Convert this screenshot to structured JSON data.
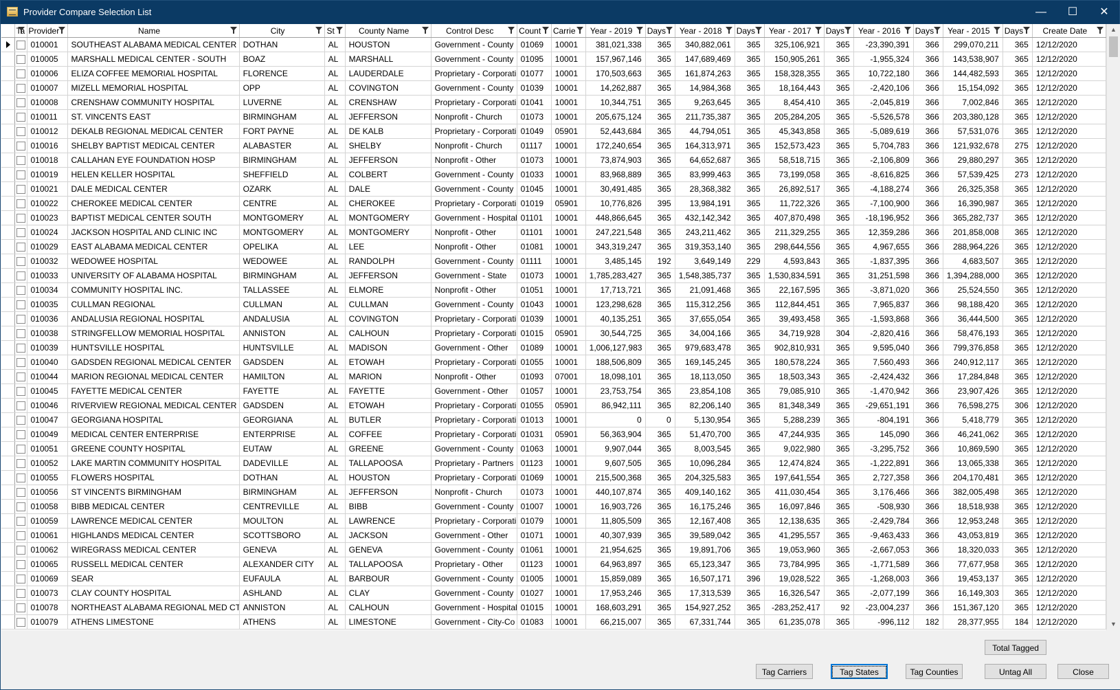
{
  "window": {
    "title": "Provider Compare Selection List",
    "minimize": "—",
    "maximize": "☐",
    "close": "✕"
  },
  "columns": [
    "Ta",
    "Provider",
    "Name",
    "City",
    "St",
    "County Name",
    "Control Desc",
    "Count",
    "Carrie",
    "Year - 2019",
    "Days",
    "Year - 2018",
    "Days",
    "Year - 2017",
    "Days",
    "Year - 2016",
    "Days",
    "Year - 2015",
    "Days",
    "Create Date"
  ],
  "rows": [
    [
      "010001",
      "SOUTHEAST ALABAMA MEDICAL CENTER",
      "DOTHAN",
      "AL",
      "HOUSTON",
      "Government - County",
      "01069",
      "10001",
      "381,021,338",
      "365",
      "340,882,061",
      "365",
      "325,106,921",
      "365",
      "-23,390,391",
      "366",
      "299,070,211",
      "365",
      "12/12/2020"
    ],
    [
      "010005",
      "MARSHALL MEDICAL CENTER - SOUTH",
      "BOAZ",
      "AL",
      "MARSHALL",
      "Government - County",
      "01095",
      "10001",
      "157,967,146",
      "365",
      "147,689,469",
      "365",
      "150,905,261",
      "365",
      "-1,955,324",
      "366",
      "143,538,907",
      "365",
      "12/12/2020"
    ],
    [
      "010006",
      "ELIZA COFFEE MEMORIAL HOSPITAL",
      "FLORENCE",
      "AL",
      "LAUDERDALE",
      "Proprietary - Corporati",
      "01077",
      "10001",
      "170,503,663",
      "365",
      "161,874,263",
      "365",
      "158,328,355",
      "365",
      "10,722,180",
      "366",
      "144,482,593",
      "365",
      "12/12/2020"
    ],
    [
      "010007",
      "MIZELL MEMORIAL HOSPITAL",
      "OPP",
      "AL",
      "COVINGTON",
      "Government - County",
      "01039",
      "10001",
      "14,262,887",
      "365",
      "14,984,368",
      "365",
      "18,164,443",
      "365",
      "-2,420,106",
      "366",
      "15,154,092",
      "365",
      "12/12/2020"
    ],
    [
      "010008",
      "CRENSHAW COMMUNITY HOSPITAL",
      "LUVERNE",
      "AL",
      "CRENSHAW",
      "Proprietary - Corporati",
      "01041",
      "10001",
      "10,344,751",
      "365",
      "9,263,645",
      "365",
      "8,454,410",
      "365",
      "-2,045,819",
      "366",
      "7,002,846",
      "365",
      "12/12/2020"
    ],
    [
      "010011",
      "ST. VINCENTS EAST",
      "BIRMINGHAM",
      "AL",
      "JEFFERSON",
      "Nonprofit - Church",
      "01073",
      "10001",
      "205,675,124",
      "365",
      "211,735,387",
      "365",
      "205,284,205",
      "365",
      "-5,526,578",
      "366",
      "203,380,128",
      "365",
      "12/12/2020"
    ],
    [
      "010012",
      "DEKALB REGIONAL MEDICAL CENTER",
      "FORT PAYNE",
      "AL",
      "DE KALB",
      "Proprietary - Corporati",
      "01049",
      "05901",
      "52,443,684",
      "365",
      "44,794,051",
      "365",
      "45,343,858",
      "365",
      "-5,089,619",
      "366",
      "57,531,076",
      "365",
      "12/12/2020"
    ],
    [
      "010016",
      "SHELBY BAPTIST MEDICAL CENTER",
      "ALABASTER",
      "AL",
      "SHELBY",
      "Nonprofit - Church",
      "01117",
      "10001",
      "172,240,654",
      "365",
      "164,313,971",
      "365",
      "152,573,423",
      "365",
      "5,704,783",
      "366",
      "121,932,678",
      "275",
      "12/12/2020"
    ],
    [
      "010018",
      "CALLAHAN EYE FOUNDATION HOSP",
      "BIRMINGHAM",
      "AL",
      "JEFFERSON",
      "Nonprofit - Other",
      "01073",
      "10001",
      "73,874,903",
      "365",
      "64,652,687",
      "365",
      "58,518,715",
      "365",
      "-2,106,809",
      "366",
      "29,880,297",
      "365",
      "12/12/2020"
    ],
    [
      "010019",
      "HELEN KELLER HOSPITAL",
      "SHEFFIELD",
      "AL",
      "COLBERT",
      "Government - County",
      "01033",
      "10001",
      "83,968,889",
      "365",
      "83,999,463",
      "365",
      "73,199,058",
      "365",
      "-8,616,825",
      "366",
      "57,539,425",
      "273",
      "12/12/2020"
    ],
    [
      "010021",
      "DALE MEDICAL CENTER",
      "OZARK",
      "AL",
      "DALE",
      "Government - County",
      "01045",
      "10001",
      "30,491,485",
      "365",
      "28,368,382",
      "365",
      "26,892,517",
      "365",
      "-4,188,274",
      "366",
      "26,325,358",
      "365",
      "12/12/2020"
    ],
    [
      "010022",
      "CHEROKEE MEDICAL CENTER",
      "CENTRE",
      "AL",
      "CHEROKEE",
      "Proprietary - Corporati",
      "01019",
      "05901",
      "10,776,826",
      "395",
      "13,984,191",
      "365",
      "11,722,326",
      "365",
      "-7,100,900",
      "366",
      "16,390,987",
      "365",
      "12/12/2020"
    ],
    [
      "010023",
      "BAPTIST MEDICAL CENTER SOUTH",
      "MONTGOMERY",
      "AL",
      "MONTGOMERY",
      "Government - Hospital",
      "01101",
      "10001",
      "448,866,645",
      "365",
      "432,142,342",
      "365",
      "407,870,498",
      "365",
      "-18,196,952",
      "366",
      "365,282,737",
      "365",
      "12/12/2020"
    ],
    [
      "010024",
      "JACKSON HOSPITAL AND CLINIC  INC",
      "MONTGOMERY",
      "AL",
      "MONTGOMERY",
      "Nonprofit - Other",
      "01101",
      "10001",
      "247,221,548",
      "365",
      "243,211,462",
      "365",
      "211,329,255",
      "365",
      "12,359,286",
      "366",
      "201,858,008",
      "365",
      "12/12/2020"
    ],
    [
      "010029",
      "EAST ALABAMA MEDICAL CENTER",
      "OPELIKA",
      "AL",
      "LEE",
      "Nonprofit - Other",
      "01081",
      "10001",
      "343,319,247",
      "365",
      "319,353,140",
      "365",
      "298,644,556",
      "365",
      "4,967,655",
      "366",
      "288,964,226",
      "365",
      "12/12/2020"
    ],
    [
      "010032",
      "WEDOWEE HOSPITAL",
      "WEDOWEE",
      "AL",
      "RANDOLPH",
      "Government - County",
      "01111",
      "10001",
      "3,485,145",
      "192",
      "3,649,149",
      "229",
      "4,593,843",
      "365",
      "-1,837,395",
      "366",
      "4,683,507",
      "365",
      "12/12/2020"
    ],
    [
      "010033",
      "UNIVERSITY OF ALABAMA HOSPITAL",
      "BIRMINGHAM",
      "AL",
      "JEFFERSON",
      "Government - State",
      "01073",
      "10001",
      "1,785,283,427",
      "365",
      "1,548,385,737",
      "365",
      "1,530,834,591",
      "365",
      "31,251,598",
      "366",
      "1,394,288,000",
      "365",
      "12/12/2020"
    ],
    [
      "010034",
      "COMMUNITY HOSPITAL INC.",
      "TALLASSEE",
      "AL",
      "ELMORE",
      "Nonprofit - Other",
      "01051",
      "10001",
      "17,713,721",
      "365",
      "21,091,468",
      "365",
      "22,167,595",
      "365",
      "-3,871,020",
      "366",
      "25,524,550",
      "365",
      "12/12/2020"
    ],
    [
      "010035",
      "CULLMAN REGIONAL",
      "CULLMAN",
      "AL",
      "CULLMAN",
      "Government - County",
      "01043",
      "10001",
      "123,298,628",
      "365",
      "115,312,256",
      "365",
      "112,844,451",
      "365",
      "7,965,837",
      "366",
      "98,188,420",
      "365",
      "12/12/2020"
    ],
    [
      "010036",
      "ANDALUSIA REGIONAL HOSPITAL",
      "ANDALUSIA",
      "AL",
      "COVINGTON",
      "Proprietary - Corporati",
      "01039",
      "10001",
      "40,135,251",
      "365",
      "37,655,054",
      "365",
      "39,493,458",
      "365",
      "-1,593,868",
      "366",
      "36,444,500",
      "365",
      "12/12/2020"
    ],
    [
      "010038",
      "STRINGFELLOW MEMORIAL HOSPITAL",
      "ANNISTON",
      "AL",
      "CALHOUN",
      "Proprietary - Corporati",
      "01015",
      "05901",
      "30,544,725",
      "365",
      "34,004,166",
      "365",
      "34,719,928",
      "304",
      "-2,820,416",
      "366",
      "58,476,193",
      "365",
      "12/12/2020"
    ],
    [
      "010039",
      "HUNTSVILLE HOSPITAL",
      "HUNTSVILLE",
      "AL",
      "MADISON",
      "Government - Other",
      "01089",
      "10001",
      "1,006,127,983",
      "365",
      "979,683,478",
      "365",
      "902,810,931",
      "365",
      "9,595,040",
      "366",
      "799,376,858",
      "365",
      "12/12/2020"
    ],
    [
      "010040",
      "GADSDEN REGIONAL MEDICAL CENTER",
      "GADSDEN",
      "AL",
      "ETOWAH",
      "Proprietary - Corporati",
      "01055",
      "10001",
      "188,506,809",
      "365",
      "169,145,245",
      "365",
      "180,578,224",
      "365",
      "7,560,493",
      "366",
      "240,912,117",
      "365",
      "12/12/2020"
    ],
    [
      "010044",
      "MARION REGIONAL MEDICAL CENTER",
      "HAMILTON",
      "AL",
      "MARION",
      "Nonprofit - Other",
      "01093",
      "07001",
      "18,098,101",
      "365",
      "18,113,050",
      "365",
      "18,503,343",
      "365",
      "-2,424,432",
      "366",
      "17,284,848",
      "365",
      "12/12/2020"
    ],
    [
      "010045",
      "FAYETTE MEDICAL CENTER",
      "FAYETTE",
      "AL",
      "FAYETTE",
      "Government - Other",
      "01057",
      "10001",
      "23,753,754",
      "365",
      "23,854,108",
      "365",
      "79,085,910",
      "365",
      "-1,470,942",
      "366",
      "23,907,426",
      "365",
      "12/12/2020"
    ],
    [
      "010046",
      "RIVERVIEW REGIONAL MEDICAL CENTER",
      "GADSDEN",
      "AL",
      "ETOWAH",
      "Proprietary - Corporati",
      "01055",
      "05901",
      "86,942,111",
      "365",
      "82,206,140",
      "365",
      "81,348,349",
      "365",
      "-29,651,191",
      "366",
      "76,598,275",
      "306",
      "12/12/2020"
    ],
    [
      "010047",
      "GEORGIANA HOSPITAL",
      "GEORGIANA",
      "AL",
      "BUTLER",
      "Proprietary - Corporati",
      "01013",
      "10001",
      "0",
      "0",
      "5,130,954",
      "365",
      "5,288,239",
      "365",
      "-804,191",
      "366",
      "5,418,779",
      "365",
      "12/12/2020"
    ],
    [
      "010049",
      "MEDICAL CENTER ENTERPRISE",
      "ENTERPRISE",
      "AL",
      "COFFEE",
      "Proprietary - Corporati",
      "01031",
      "05901",
      "56,363,904",
      "365",
      "51,470,700",
      "365",
      "47,244,935",
      "365",
      "145,090",
      "366",
      "46,241,062",
      "365",
      "12/12/2020"
    ],
    [
      "010051",
      "GREENE COUNTY HOSPITAL",
      "EUTAW",
      "AL",
      "GREENE",
      "Government - County",
      "01063",
      "10001",
      "9,907,044",
      "365",
      "8,003,545",
      "365",
      "9,022,980",
      "365",
      "-3,295,752",
      "366",
      "10,869,590",
      "365",
      "12/12/2020"
    ],
    [
      "010052",
      "LAKE MARTIN COMMUNITY HOSPITAL",
      "DADEVILLE",
      "AL",
      "TALLAPOOSA",
      "Proprietary - Partners",
      "01123",
      "10001",
      "9,607,505",
      "365",
      "10,096,284",
      "365",
      "12,474,824",
      "365",
      "-1,222,891",
      "366",
      "13,065,338",
      "365",
      "12/12/2020"
    ],
    [
      "010055",
      "FLOWERS HOSPITAL",
      "DOTHAN",
      "AL",
      "HOUSTON",
      "Proprietary - Corporati",
      "01069",
      "10001",
      "215,500,368",
      "365",
      "204,325,583",
      "365",
      "197,641,554",
      "365",
      "2,727,358",
      "366",
      "204,170,481",
      "365",
      "12/12/2020"
    ],
    [
      "010056",
      "ST VINCENTS BIRMINGHAM",
      "BIRMINGHAM",
      "AL",
      "JEFFERSON",
      "Nonprofit - Church",
      "01073",
      "10001",
      "440,107,874",
      "365",
      "409,140,162",
      "365",
      "411,030,454",
      "365",
      "3,176,466",
      "366",
      "382,005,498",
      "365",
      "12/12/2020"
    ],
    [
      "010058",
      "BIBB MEDICAL CENTER",
      "CENTREVILLE",
      "AL",
      "BIBB",
      "Government - County",
      "01007",
      "10001",
      "16,903,726",
      "365",
      "16,175,246",
      "365",
      "16,097,846",
      "365",
      "-508,930",
      "366",
      "18,518,938",
      "365",
      "12/12/2020"
    ],
    [
      "010059",
      "LAWRENCE MEDICAL CENTER",
      "MOULTON",
      "AL",
      "LAWRENCE",
      "Proprietary - Corporati",
      "01079",
      "10001",
      "11,805,509",
      "365",
      "12,167,408",
      "365",
      "12,138,635",
      "365",
      "-2,429,784",
      "366",
      "12,953,248",
      "365",
      "12/12/2020"
    ],
    [
      "010061",
      "HIGHLANDS MEDICAL CENTER",
      "SCOTTSBORO",
      "AL",
      "JACKSON",
      "Government - Other",
      "01071",
      "10001",
      "40,307,939",
      "365",
      "39,589,042",
      "365",
      "41,295,557",
      "365",
      "-9,463,433",
      "366",
      "43,053,819",
      "365",
      "12/12/2020"
    ],
    [
      "010062",
      "WIREGRASS MEDICAL CENTER",
      "GENEVA",
      "AL",
      "GENEVA",
      "Government - County",
      "01061",
      "10001",
      "21,954,625",
      "365",
      "19,891,706",
      "365",
      "19,053,960",
      "365",
      "-2,667,053",
      "366",
      "18,320,033",
      "365",
      "12/12/2020"
    ],
    [
      "010065",
      "RUSSELL MEDICAL CENTER",
      "ALEXANDER CITY",
      "AL",
      "TALLAPOOSA",
      "Proprietary - Other",
      "01123",
      "10001",
      "64,963,897",
      "365",
      "65,123,347",
      "365",
      "73,784,995",
      "365",
      "-1,771,589",
      "366",
      "77,677,958",
      "365",
      "12/12/2020"
    ],
    [
      "010069",
      "SEAR",
      "EUFAULA",
      "AL",
      "BARBOUR",
      "Government - County",
      "01005",
      "10001",
      "15,859,089",
      "365",
      "16,507,171",
      "396",
      "19,028,522",
      "365",
      "-1,268,003",
      "366",
      "19,453,137",
      "365",
      "12/12/2020"
    ],
    [
      "010073",
      "CLAY COUNTY HOSPITAL",
      "ASHLAND",
      "AL",
      "CLAY",
      "Government - County",
      "01027",
      "10001",
      "17,953,246",
      "365",
      "17,313,539",
      "365",
      "16,326,547",
      "365",
      "-2,077,199",
      "366",
      "16,149,303",
      "365",
      "12/12/2020"
    ],
    [
      "010078",
      "NORTHEAST ALABAMA REGIONAL MED CT",
      "ANNISTON",
      "AL",
      "CALHOUN",
      "Government - Hospital",
      "01015",
      "10001",
      "168,603,291",
      "365",
      "154,927,252",
      "365",
      "-283,252,417",
      "92",
      "-23,004,237",
      "366",
      "151,367,120",
      "365",
      "12/12/2020"
    ],
    [
      "010079",
      "ATHENS LIMESTONE",
      "ATHENS",
      "AL",
      "LIMESTONE",
      "Government - City-Co",
      "01083",
      "10001",
      "66,215,007",
      "365",
      "67,331,744",
      "365",
      "61,235,078",
      "365",
      "-996,112",
      "182",
      "28,377,955",
      "184",
      "12/12/2020"
    ]
  ],
  "buttons": {
    "total_tagged": "Total Tagged",
    "tag_carriers": "Tag Carriers",
    "tag_states": "Tag States",
    "tag_counties": "Tag Counties",
    "untag_all": "Untag All",
    "close": "Close"
  }
}
